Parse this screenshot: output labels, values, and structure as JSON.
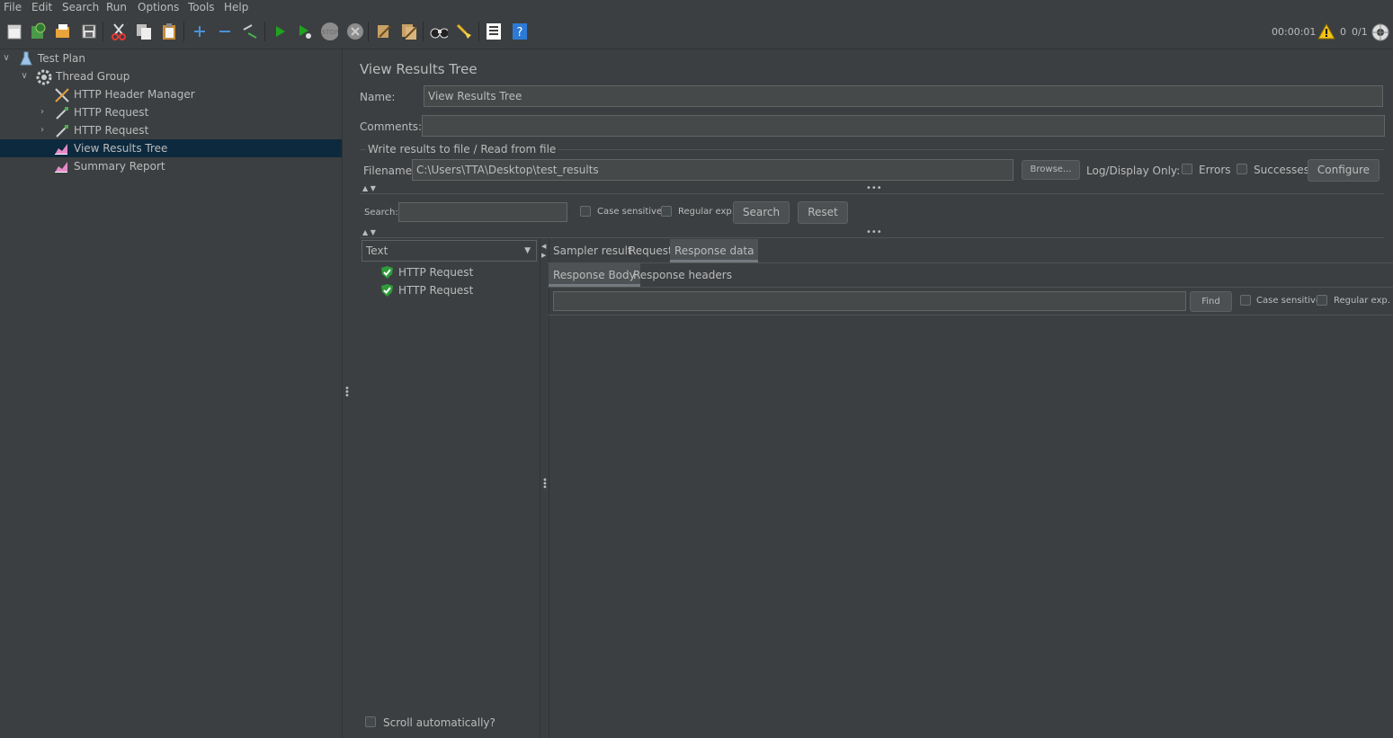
{
  "menubar": {
    "items": [
      "File",
      "Edit",
      "Search",
      "Run",
      "Options",
      "Tools",
      "Help"
    ]
  },
  "toolbar": {
    "elapsed": "00:00:01",
    "warning_count": "0",
    "threads": "0/1"
  },
  "tree": {
    "items": [
      {
        "label": "Test Plan",
        "icon": "test-plan-icon"
      },
      {
        "label": "Thread Group",
        "icon": "gear-icon"
      },
      {
        "label": "HTTP Header Manager",
        "icon": "tools-icon"
      },
      {
        "label": "HTTP Request",
        "icon": "pipette-icon"
      },
      {
        "label": "HTTP Request",
        "icon": "pipette-icon"
      },
      {
        "label": "View Results Tree",
        "icon": "chart-icon"
      },
      {
        "label": "Summary Report",
        "icon": "chart-icon"
      }
    ]
  },
  "panel": {
    "title": "View Results Tree",
    "name_label": "Name:",
    "name_value": "View Results Tree",
    "comments_label": "Comments:",
    "comments_value": "",
    "file_group_label": "Write results to file / Read from file",
    "filename_label": "Filename",
    "filename_value": "C:\\Users\\TTA\\Desktop\\test_results",
    "browse_label": "Browse...",
    "log_display_label": "Log/Display Only:",
    "errors_label": "Errors",
    "successes_label": "Successes",
    "configure_label": "Configure"
  },
  "search": {
    "label": "Search:",
    "value": "",
    "case_sensitive_label": "Case sensitive",
    "regex_label": "Regular exp.",
    "search_button": "Search",
    "reset_button": "Reset"
  },
  "results": {
    "renderer_selected": "Text",
    "samples": [
      "HTTP Request",
      "HTTP Request"
    ],
    "scroll_auto_label": "Scroll automatically?"
  },
  "detail": {
    "tabs": [
      "Sampler result",
      "Request",
      "Response data"
    ],
    "active_tab": "Response data",
    "subtabs": [
      "Response Body",
      "Response headers"
    ],
    "active_subtab": "Response Body",
    "find_value": "",
    "find_button": "Find",
    "case_sensitive_label": "Case sensitive",
    "regex_label": "Regular exp."
  }
}
